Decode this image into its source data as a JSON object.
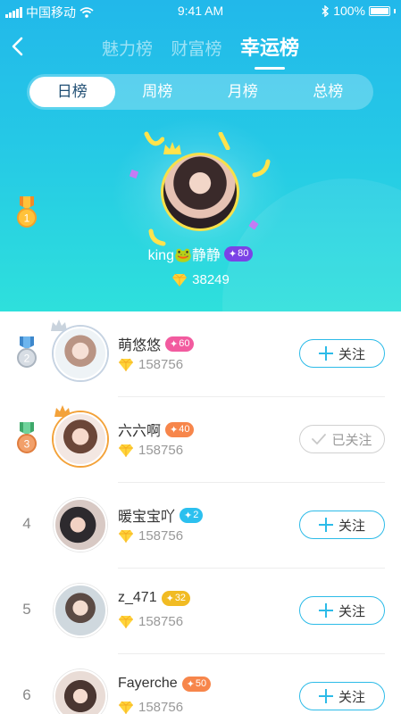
{
  "status_bar": {
    "carrier": "中国移动",
    "time": "9:41 AM",
    "battery": "100%",
    "icons": [
      "signal-icon",
      "wifi-icon",
      "bluetooth-icon",
      "battery-icon"
    ]
  },
  "nav": {
    "back_icon": "back-arrow-icon",
    "tabs": [
      {
        "label": "魅力榜"
      },
      {
        "label": "财富榜"
      },
      {
        "label": "幸运榜"
      }
    ],
    "active_tab": "幸运榜"
  },
  "period_tabs": [
    {
      "label": "日榜"
    },
    {
      "label": "周榜"
    },
    {
      "label": "月榜"
    },
    {
      "label": "总榜"
    }
  ],
  "active_period": "日榜",
  "top": {
    "rank": "1",
    "name": "king🐸静静",
    "level": "80",
    "score": "38249"
  },
  "list": [
    {
      "rank": "2",
      "name": "萌悠悠",
      "level": "60",
      "score": "158756",
      "follow_label": "关注",
      "followed": false
    },
    {
      "rank": "3",
      "name": "六六啊",
      "level": "40",
      "score": "158756",
      "follow_label": "已关注",
      "followed": true
    },
    {
      "rank": "4",
      "name": "暖宝宝吖",
      "level": "2",
      "score": "158756",
      "follow_label": "关注",
      "followed": false
    },
    {
      "rank": "5",
      "name": "z_471",
      "level": "32",
      "score": "158756",
      "follow_label": "关注",
      "followed": false
    },
    {
      "rank": "6",
      "name": "Fayerche",
      "level": "50",
      "score": "158756",
      "follow_label": "关注",
      "followed": false
    }
  ],
  "colors": {
    "header_top": "#22b8ea",
    "header_bottom": "#2ee0dc",
    "accent": "#2cbbe8",
    "gold": "#f7e04a"
  }
}
